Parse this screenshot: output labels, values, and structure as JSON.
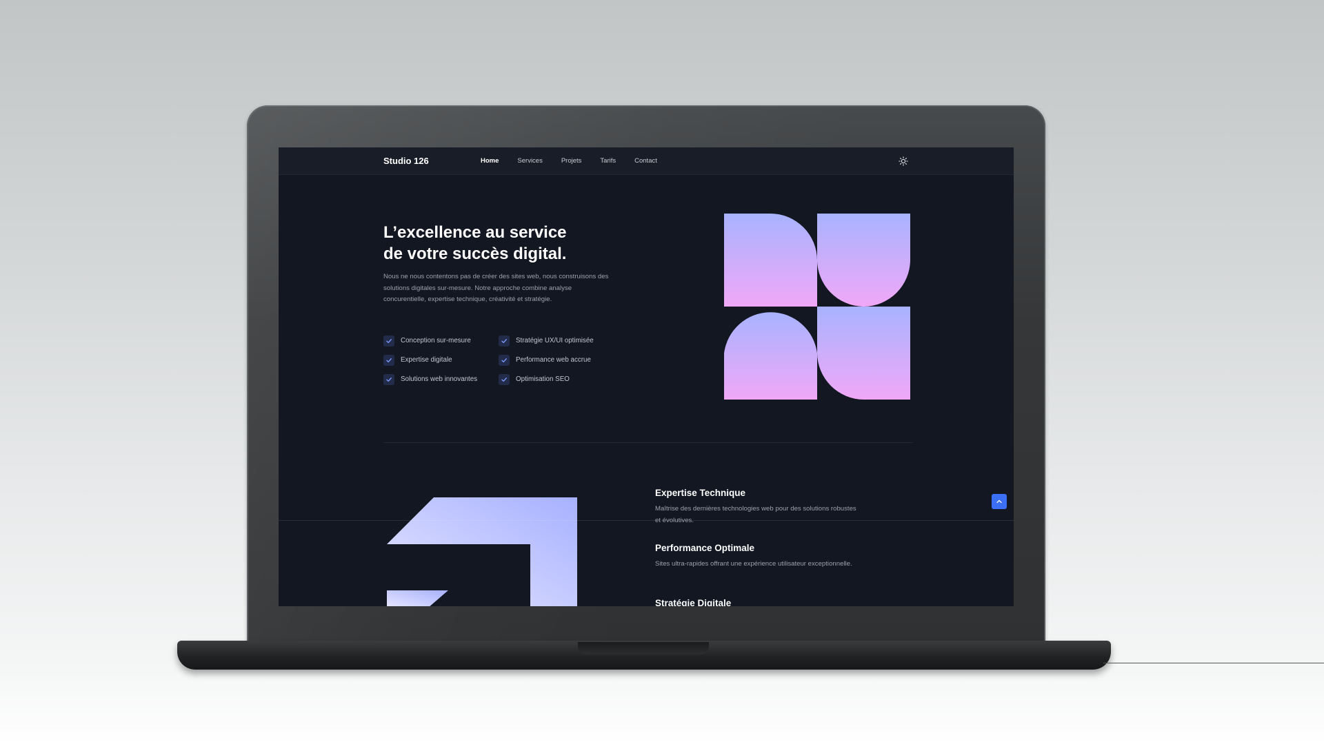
{
  "nav": {
    "brand": "Studio 126",
    "links": [
      "Home",
      "Services",
      "Projets",
      "Tarifs",
      "Contact"
    ],
    "active": "Home",
    "theme_icon": "sun-icon"
  },
  "hero": {
    "title_line1": "L’excellence au service",
    "title_line2": "de votre succès digital.",
    "description": "Nous ne nous contentons pas de créer des sites web, nous construisons des solutions digitales sur-mesure. Notre approche combine analyse concurentielle, expertise technique, créativité et stratégie.",
    "features": [
      "Conception sur-mesure",
      "Stratégie UX/UI optimisée",
      "Expertise digitale",
      "Performance web accrue",
      "Solutions web innovantes",
      "Optimisation SEO"
    ]
  },
  "services": [
    {
      "title": "Expertise Technique",
      "description": "Maîtrise des dernières technologies web pour des solutions robustes et évolutives."
    },
    {
      "title": "Performance Optimale",
      "description": "Sites ultra-rapides offrant une expérience utilisateur exceptionnelle."
    },
    {
      "title": "Stratégie Digitale",
      "description": ""
    }
  ],
  "colors": {
    "accent": "#3b6ff5",
    "gradient_top": "#a8b3ff",
    "gradient_bottom": "#f0a8f7",
    "background": "#131722"
  }
}
